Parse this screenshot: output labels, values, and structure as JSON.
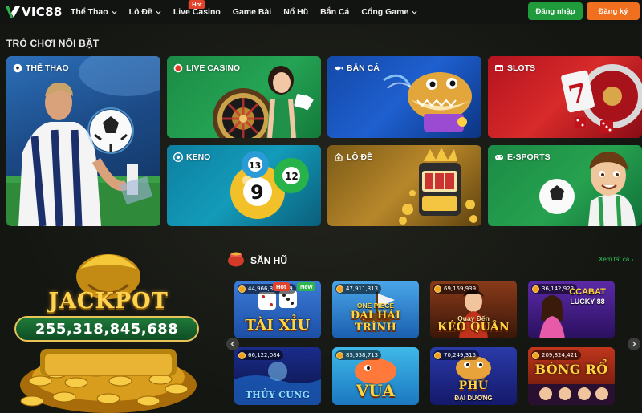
{
  "header": {
    "logo_text": "VIC88",
    "nav": [
      {
        "label": "Thể Thao",
        "has_chevron": true
      },
      {
        "label": "Lô Đề",
        "has_chevron": true
      },
      {
        "label": "Live Casino",
        "has_chevron": false,
        "tag": "Hot"
      },
      {
        "label": "Game Bài",
        "has_chevron": false
      },
      {
        "label": "Nổ Hũ",
        "has_chevron": false
      },
      {
        "label": "Bắn Cá",
        "has_chevron": false
      },
      {
        "label": "Cổng Game",
        "has_chevron": true
      }
    ],
    "login_label": "Đăng nhập",
    "register_label": "Đăng ký"
  },
  "featured": {
    "title": "TRÒ CHƠI NỔI BẬT",
    "cards": [
      {
        "label": "THỂ THAO",
        "icon": "soccer-ball-icon"
      },
      {
        "label": "LIVE CASINO",
        "icon": "red-dot-icon"
      },
      {
        "label": "BẮN CÁ",
        "icon": "fish-icon"
      },
      {
        "label": "SLOTS",
        "icon": "slot-machine-icon"
      },
      {
        "label": "KENO",
        "icon": "keno-ball-icon"
      },
      {
        "label": "LÔ ĐỀ",
        "icon": "lottery-icon"
      },
      {
        "label": "E-SPORTS",
        "icon": "gamepad-icon"
      }
    ]
  },
  "jackpot": {
    "word": "JACKPOT",
    "amount": "255,318,845,688"
  },
  "san_hu": {
    "title": "SĂN HŨ",
    "see_all": "Xem tất cả",
    "games": [
      {
        "jackpot": "44,966,359,169",
        "title": "TÀI XỈU",
        "badges": [
          "Hot",
          "New"
        ]
      },
      {
        "jackpot": "47,911,313",
        "title": "ĐẠI HẢI TRÌNH",
        "subtitle": "ONE PIECE"
      },
      {
        "jackpot": "69,159,939",
        "title": "KÉO QUÂN",
        "subtitle": "Quay Đến"
      },
      {
        "jackpot": "36,142,922",
        "title": "LUCKY 88",
        "subtitle": "CCABAT"
      },
      {
        "jackpot": "66,122,084",
        "title": "THỦY CUNG"
      },
      {
        "jackpot": "85,938,713",
        "title": "VUA"
      },
      {
        "jackpot": "70,249,315",
        "title": "PHÚ",
        "subtitle": "ĐẠI DƯƠNG"
      },
      {
        "jackpot": "209,824,421",
        "title": "BÓNG RỔ"
      }
    ]
  },
  "colors": {
    "background": "#141612",
    "login": "#1f9b3c",
    "register": "#f0701f",
    "hot_tag": "#e2432a",
    "accent_green": "#2fc85a",
    "gold": "#ffd34e"
  }
}
